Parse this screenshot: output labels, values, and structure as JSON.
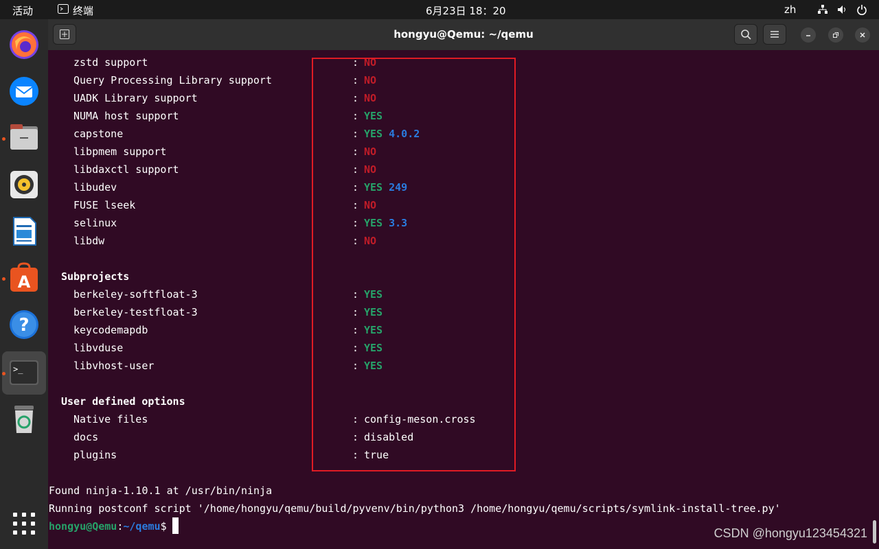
{
  "topbar": {
    "activities": "活动",
    "app_name": "终端",
    "clock": "6月23日  18：20",
    "lang": "zh"
  },
  "window": {
    "title": "hongyu@Qemu: ~/qemu"
  },
  "terminal": {
    "features": [
      {
        "label": "zstd support",
        "value": "NO",
        "status": "no"
      },
      {
        "label": "Query Processing Library support",
        "value": "NO",
        "status": "no"
      },
      {
        "label": "UADK Library support",
        "value": "NO",
        "status": "no"
      },
      {
        "label": "NUMA host support",
        "value": "YES",
        "status": "yes"
      },
      {
        "label": "capstone",
        "value": "YES",
        "status": "yes",
        "version": "4.0.2"
      },
      {
        "label": "libpmem support",
        "value": "NO",
        "status": "no"
      },
      {
        "label": "libdaxctl support",
        "value": "NO",
        "status": "no"
      },
      {
        "label": "libudev",
        "value": "YES",
        "status": "yes",
        "version": "249"
      },
      {
        "label": "FUSE lseek",
        "value": "NO",
        "status": "no"
      },
      {
        "label": "selinux",
        "value": "YES",
        "status": "yes",
        "version": "3.3"
      },
      {
        "label": "libdw",
        "value": "NO",
        "status": "no"
      }
    ],
    "subprojects_heading": "Subprojects",
    "subprojects": [
      {
        "label": "berkeley-softfloat-3",
        "value": "YES"
      },
      {
        "label": "berkeley-testfloat-3",
        "value": "YES"
      },
      {
        "label": "keycodemapdb",
        "value": "YES"
      },
      {
        "label": "libvduse",
        "value": "YES"
      },
      {
        "label": "libvhost-user",
        "value": "YES"
      }
    ],
    "user_options_heading": "User defined options",
    "user_options": [
      {
        "label": "Native files",
        "value": "config-meson.cross"
      },
      {
        "label": "docs",
        "value": "disabled"
      },
      {
        "label": "plugins",
        "value": "true"
      }
    ],
    "colon": ":",
    "found_ninja": "Found ninja-1.10.1 at /usr/bin/ninja",
    "postconf": "Running postconf script '/home/hongyu/qemu/build/pyvenv/bin/python3 /home/hongyu/qemu/scripts/symlink-install-tree.py'",
    "prompt_user": "hongyu@Qemu",
    "prompt_sep": ":",
    "prompt_path": "~/qemu",
    "prompt_symbol": "$"
  },
  "watermark": "CSDN @hongyu123454321",
  "dock": {
    "items": [
      {
        "name": "firefox-icon"
      },
      {
        "name": "thunderbird-icon"
      },
      {
        "name": "files-icon"
      },
      {
        "name": "rhythmbox-icon"
      },
      {
        "name": "writer-icon"
      },
      {
        "name": "software-center-icon"
      },
      {
        "name": "help-icon"
      },
      {
        "name": "terminal-icon"
      },
      {
        "name": "trash-icon"
      },
      {
        "name": "show-apps-icon"
      }
    ]
  },
  "colors": {
    "no": "#c01c28",
    "yes": "#26a269",
    "version": "#2a7bde",
    "terminal_bg": "#300a24",
    "highlight_box": "#e01b24"
  }
}
